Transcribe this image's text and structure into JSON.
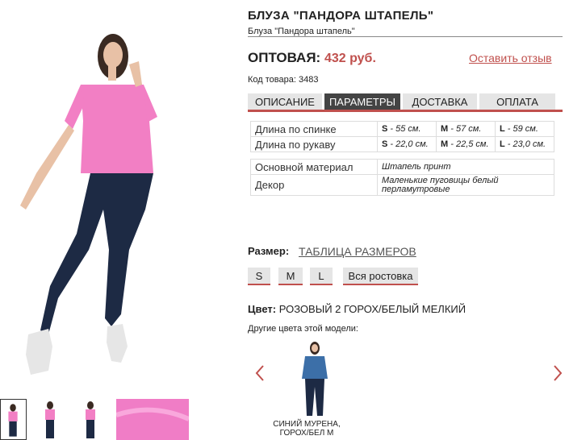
{
  "product": {
    "title": "БЛУЗА \"ПАНДОРА ШТАПЕЛЬ\"",
    "subtitle": "Блуза \"Пандора штапель\"",
    "price_label": "ОПТОВАЯ:",
    "price_value": "432 руб.",
    "review_link": "Оставить отзыв",
    "code": "Код товара: 3483"
  },
  "tabs": [
    {
      "label": "ОПИСАНИЕ",
      "active": false
    },
    {
      "label": "ПАРАМЕТРЫ",
      "active": true
    },
    {
      "label": "ДОСТАВКА",
      "active": false
    },
    {
      "label": "ОПЛАТА",
      "active": false
    }
  ],
  "measurements": [
    {
      "label": "Длина по спинке",
      "s": "- 55 см.",
      "m": "- 57 см.",
      "l": "- 59 см."
    },
    {
      "label": "Длина по рукаву",
      "s": "- 22,0 см.",
      "m": "- 22,5 см.",
      "l": "- 23,0 см."
    }
  ],
  "size_letters": {
    "s": "S",
    "m": "M",
    "l": "L"
  },
  "attributes": [
    {
      "label": "Основной материал",
      "value": "Штапель принт"
    },
    {
      "label": "Декор",
      "value": "Маленькие пуговицы белый перламутровые"
    }
  ],
  "size": {
    "label": "Размер:",
    "table_link": "ТАБЛИЦА РАЗМЕРОВ",
    "options": [
      "S",
      "M",
      "L",
      "Вся ростовка"
    ]
  },
  "color": {
    "label": "Цвет:",
    "value": "РОЗОВЫЙ 2 ГОРОХ/БЕЛЫЙ МЕЛКИЙ",
    "other_label": "Другие цвета этой модели:",
    "variant_label": "СИНИЙ МУРЕНА, ГОРОХ/БЕЛ М"
  },
  "colors": {
    "accent": "#c0504d",
    "blouse_pink": "#f27fc4",
    "jeans": "#1d2a44"
  }
}
